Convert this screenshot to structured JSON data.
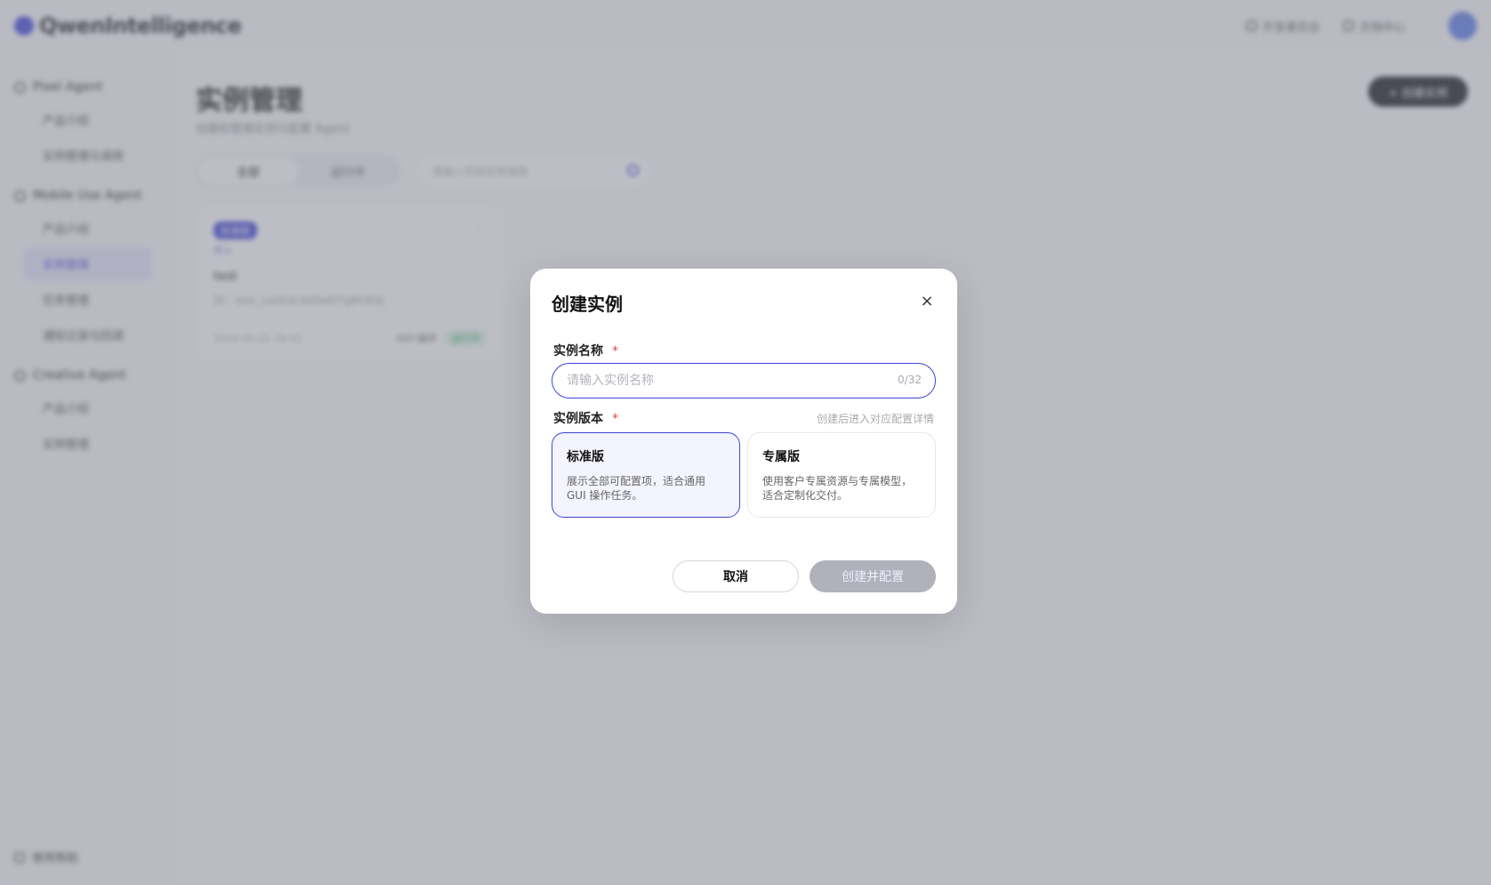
{
  "topbar": {
    "logo_text": "QwenIntelligence",
    "links": [
      "开发者后台",
      "文档中心"
    ]
  },
  "sidebar": {
    "groups": [
      {
        "title": "Pixel Agent",
        "items": [
          "产品介绍",
          "实例管理与调用"
        ]
      },
      {
        "title": "Mobile Use Agent",
        "items": [
          "产品介绍",
          "实例管理",
          "任务管理",
          "通知记录与回调"
        ]
      },
      {
        "title": "Creative Agent",
        "items": [
          "产品介绍",
          "实例管理"
        ]
      }
    ],
    "active_group": 1,
    "active_item": 1,
    "bottom_label": "使用帮助"
  },
  "main": {
    "title": "实例管理",
    "subtitle": "创建和管理实例与配置 Agent",
    "create_button": "+ 创建实例",
    "tabs": [
      "全部",
      "运行中"
    ],
    "search_placeholder": "请输入实例名称搜索",
    "instance_card": {
      "badge": "标准版",
      "sub": "默认",
      "name": "test",
      "desc": "ID：inst_1a2b3c4d5e6f7g8h9i0j",
      "created": "2024-05-21 18:32",
      "tag": "GUI 操作",
      "status": "运行中"
    }
  },
  "modal": {
    "title": "创建实例",
    "close_icon": "×",
    "name_label": "实例名称",
    "required_mark": "*",
    "name_placeholder": "请输入实例名称",
    "name_counter": "0/32",
    "version_label": "实例版本",
    "version_hint": "创建后进入对应配置详情",
    "options": [
      {
        "title": "标准版",
        "desc": "展示全部可配置项，适合通用 GUI 操作任务。"
      },
      {
        "title": "专属版",
        "desc": "使用客户专属资源与专属模型，适合定制化交付。"
      }
    ],
    "selected_option": 0,
    "cancel_label": "取消",
    "create_label": "创建并配置"
  }
}
